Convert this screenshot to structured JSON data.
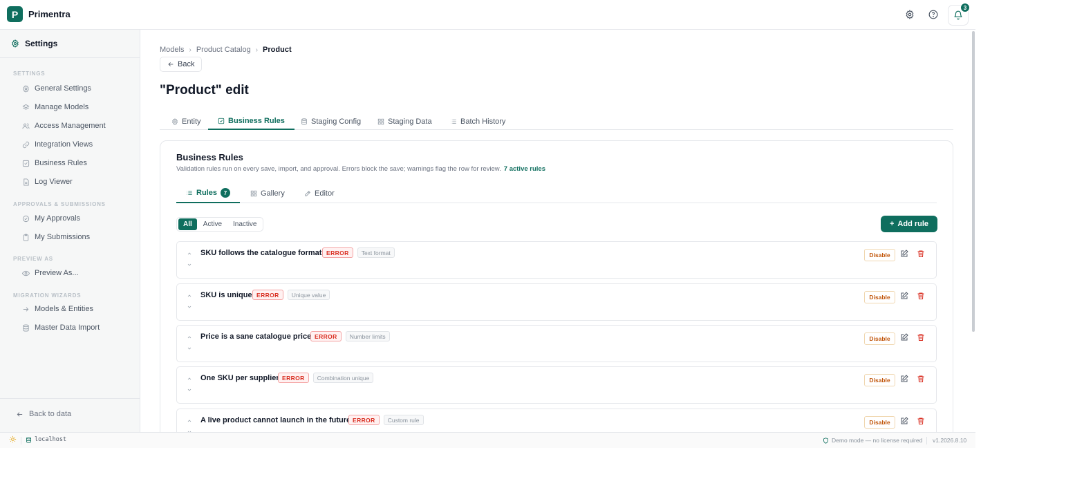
{
  "app": {
    "logo_letter": "P",
    "name": "Primentra",
    "notification_count": "3"
  },
  "sidebar": {
    "title": "Settings",
    "sections": [
      {
        "label": "SETTINGS",
        "items": [
          "General Settings",
          "Manage Models",
          "Access Management",
          "Integration Views",
          "Business Rules",
          "Log Viewer"
        ]
      },
      {
        "label": "APPROVALS & SUBMISSIONS",
        "items": [
          "My Approvals",
          "My Submissions"
        ]
      },
      {
        "label": "PREVIEW AS",
        "items": [
          "Preview As..."
        ]
      },
      {
        "label": "MIGRATION WIZARDS",
        "items": [
          "Models & Entities",
          "Master Data Import"
        ]
      }
    ],
    "back_label": "Back to data"
  },
  "breadcrumb": {
    "items": [
      "Models",
      "Product Catalog"
    ],
    "current": "Product"
  },
  "back_button": "Back",
  "page_title": "\"Product\" edit",
  "tabs": [
    "Entity",
    "Business Rules",
    "Staging Config",
    "Staging Data",
    "Batch History"
  ],
  "active_tab": "Business Rules",
  "card": {
    "title": "Business Rules",
    "description": "Validation rules run on every save, import, and approval. Errors block the save; warnings flag the row for review.",
    "active_count": "7 active rules",
    "subtabs": [
      "Rules",
      "Gallery",
      "Editor"
    ],
    "rules_count": "7",
    "filters": [
      "All",
      "Active",
      "Inactive"
    ],
    "active_filter": "All",
    "add_rule_label": "Add rule",
    "rules": [
      {
        "name": "SKU follows the catalogue format",
        "severity": "ERROR",
        "type": "Text format",
        "action": "Disable"
      },
      {
        "name": "SKU is unique",
        "severity": "ERROR",
        "type": "Unique value",
        "action": "Disable"
      },
      {
        "name": "Price is a sane catalogue price",
        "severity": "ERROR",
        "type": "Number limits",
        "action": "Disable"
      },
      {
        "name": "One SKU per supplier",
        "severity": "ERROR",
        "type": "Combination unique",
        "action": "Disable"
      },
      {
        "name": "A live product cannot launch in the future",
        "severity": "ERROR",
        "type": "Custom rule",
        "action": "Disable"
      }
    ]
  },
  "statusbar": {
    "host": "localhost",
    "demo": "Demo mode — no license required",
    "version": "v1.2026.8.10"
  },
  "colors": {
    "brand": "#0f6e5e",
    "error": "#d92d20",
    "warning": "#c2570c"
  }
}
